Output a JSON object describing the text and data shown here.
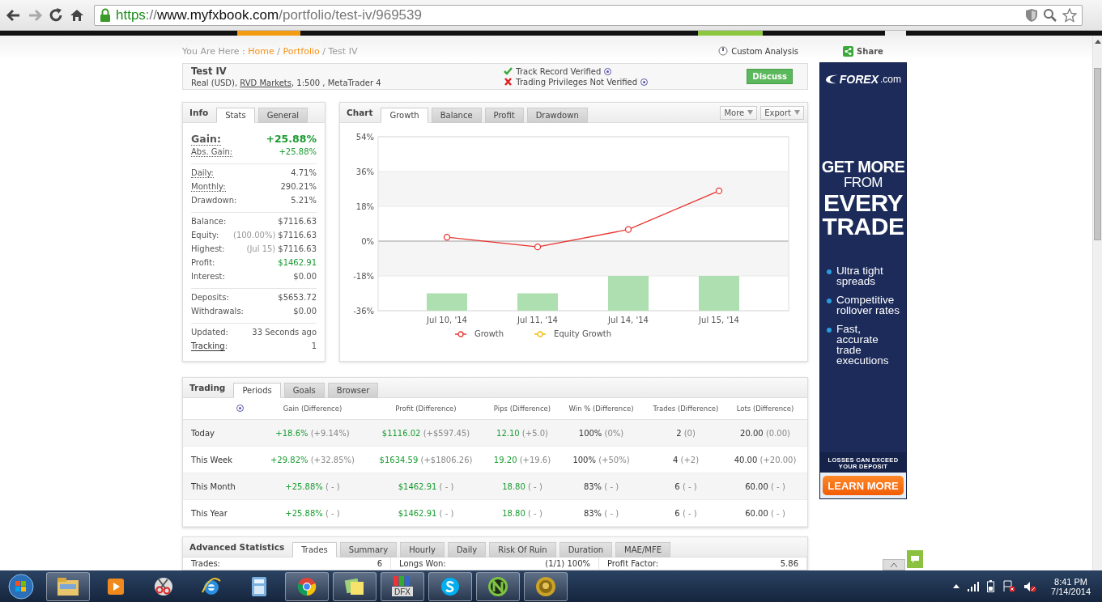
{
  "browser": {
    "url_parts": [
      {
        "kind": "scheme",
        "text": "https"
      },
      {
        "kind": "sep",
        "text": "://"
      },
      {
        "kind": "host",
        "text": "www.myfxbook.com"
      },
      {
        "kind": "path",
        "text": "/portfolio/test-iv/969539"
      }
    ]
  },
  "breadcrumb": {
    "prefix": "You Are Here :",
    "links": [
      "Home",
      "Portfolio"
    ],
    "separator": "/",
    "current": "Test IV"
  },
  "custom_analysis": "Custom Analysis",
  "share": "Share",
  "account": {
    "name": "Test IV",
    "type": "Real (USD),",
    "broker": "RVD Markets",
    "details": ", 1:500 , MetaTrader 4",
    "verifications": [
      {
        "text": "Track Record Verified",
        "verified": true
      },
      {
        "text": "Trading Privileges Not Verified",
        "verified": false
      }
    ],
    "discuss": "Discuss"
  },
  "info": {
    "title": "Info",
    "tabs": [
      {
        "label": "Stats",
        "selected": true
      },
      {
        "label": "General",
        "selected": false
      }
    ],
    "groups": [
      [
        {
          "label": "Gain:",
          "value": "+25.88%",
          "kind": "headline",
          "positive": true,
          "dotted": true
        },
        {
          "label": "Abs. Gain:",
          "value": "+25.88%",
          "positive": true,
          "dotted": true
        }
      ],
      [
        {
          "label": "Daily:",
          "value": "4.71%",
          "dotted": true
        },
        {
          "label": "Monthly:",
          "value": "290.21%",
          "dotted": true
        },
        {
          "label": "Drawdown:",
          "value": "5.21%"
        }
      ],
      [
        {
          "label": "Balance:",
          "value": "$7116.63"
        },
        {
          "label": "Equity:",
          "note": "(100.00%)",
          "value": "$7116.63"
        },
        {
          "label": "Highest:",
          "note": "(Jul 15)",
          "value": "$7116.63"
        },
        {
          "label": "Profit:",
          "value": "$1462.91",
          "positive": true
        },
        {
          "label": "Interest:",
          "value": "$0.00"
        }
      ],
      [
        {
          "label": "Deposits:",
          "value": "$5653.72"
        },
        {
          "label": "Withdrawals:",
          "value": "$0.00"
        }
      ],
      [
        {
          "label": "Updated:",
          "value": "33 Seconds ago"
        },
        {
          "label": "Tracking",
          "suffix": ":",
          "value": "1",
          "link": true
        }
      ]
    ]
  },
  "chart": {
    "title": "Chart",
    "tabs": [
      {
        "label": "Growth",
        "selected": true
      },
      {
        "label": "Balance",
        "selected": false
      },
      {
        "label": "Profit",
        "selected": false
      },
      {
        "label": "Drawdown",
        "selected": false
      }
    ],
    "menus": [
      "More",
      "Export"
    ],
    "chart_data": {
      "type": "line",
      "grid": true,
      "categories": [
        "Jul 10, '14",
        "Jul 11, '14",
        "Jul 14, '14",
        "Jul 15, '14"
      ],
      "ylim": [
        -36,
        54
      ],
      "yticks": [
        {
          "value": 54,
          "label": "54%"
        },
        {
          "value": 36,
          "label": "36%"
        },
        {
          "value": 18,
          "label": "18%"
        },
        {
          "value": 0,
          "label": "0%"
        },
        {
          "value": -18,
          "label": "-18%"
        },
        {
          "value": -36,
          "label": "-36%"
        }
      ],
      "series": [
        {
          "name": "Growth",
          "color": "#e8332f",
          "marker": "circle",
          "values": [
            2,
            -3,
            6,
            26
          ]
        },
        {
          "name": "Equity Growth",
          "color": "#f5b800",
          "marker": "circle",
          "values": [
            null,
            null,
            null,
            null
          ]
        },
        {
          "type": "bar",
          "base": [
            -36,
            -36,
            -36,
            -36
          ],
          "color": "#addfb1",
          "values": [
            9,
            9,
            18,
            18
          ]
        }
      ]
    }
  },
  "trading": {
    "title": "Trading",
    "tabs": [
      {
        "label": "Periods",
        "selected": true
      },
      {
        "label": "Goals",
        "selected": false
      },
      {
        "label": "Browser",
        "selected": false
      }
    ],
    "columns": [
      "Gain (Difference)",
      "Profit (Difference)",
      "Pips (Difference)",
      "Win % (Difference)",
      "Trades (Difference)",
      "Lots (Difference)"
    ],
    "rows": [
      {
        "label": "Today",
        "cells": [
          {
            "value": "+18.6%",
            "diff": "(+9.14%)",
            "positive": true
          },
          {
            "value": "$1116.02",
            "diff": "(+$597.45)",
            "positive": true
          },
          {
            "value": "12.10",
            "diff": "(+5.0)",
            "positive": true
          },
          {
            "value": "100%",
            "diff": "(0%)"
          },
          {
            "value": "2",
            "diff": "(0)"
          },
          {
            "value": "20.00",
            "diff": "(0.00)"
          }
        ]
      },
      {
        "label": "This Week",
        "cells": [
          {
            "value": "+29.82%",
            "diff": "(+32.85%)",
            "positive": true
          },
          {
            "value": "$1634.59",
            "diff": "(+$1806.26)",
            "positive": true
          },
          {
            "value": "19.20",
            "diff": "(+19.6)",
            "positive": true
          },
          {
            "value": "100%",
            "diff": "(+50%)"
          },
          {
            "value": "4",
            "diff": "(+2)"
          },
          {
            "value": "40.00",
            "diff": "(+20.00)"
          }
        ]
      },
      {
        "label": "This Month",
        "cells": [
          {
            "value": "+25.88%",
            "diff": "( - )",
            "positive": true
          },
          {
            "value": "$1462.91",
            "diff": "( - )",
            "positive": true
          },
          {
            "value": "18.80",
            "diff": "( - )",
            "positive": true
          },
          {
            "value": "83%",
            "diff": "( - )"
          },
          {
            "value": "6",
            "diff": "( - )"
          },
          {
            "value": "60.00",
            "diff": "( - )"
          }
        ]
      },
      {
        "label": "This Year",
        "cells": [
          {
            "value": "+25.88%",
            "diff": "( - )",
            "positive": true
          },
          {
            "value": "$1462.91",
            "diff": "( - )",
            "positive": true
          },
          {
            "value": "18.80",
            "diff": "( - )",
            "positive": true
          },
          {
            "value": "83%",
            "diff": "( - )"
          },
          {
            "value": "6",
            "diff": "( - )"
          },
          {
            "value": "60.00",
            "diff": "( - )"
          }
        ]
      }
    ]
  },
  "advanced": {
    "title": "Advanced Statistics",
    "tabs": [
      {
        "label": "Trades",
        "selected": true
      },
      {
        "label": "Summary",
        "selected": false
      },
      {
        "label": "Hourly",
        "selected": false
      },
      {
        "label": "Daily",
        "selected": false
      },
      {
        "label": "Risk Of Ruin",
        "selected": false
      },
      {
        "label": "Duration",
        "selected": false
      },
      {
        "label": "MAE/MFE",
        "selected": false
      }
    ],
    "stats": [
      {
        "label": "Trades:",
        "value": "6"
      },
      {
        "label": "Longs Won:",
        "value": "(1/1) 100%"
      },
      {
        "label": "Profit Factor:",
        "value": "5.86"
      }
    ]
  },
  "ad": {
    "logo_bold": "FOREX",
    "logo_rest": ".com",
    "headline": [
      {
        "text": "GET MORE",
        "kind": "bold"
      },
      {
        "text": "FROM",
        "kind": "light"
      },
      {
        "text": "EVERY",
        "kind": "big"
      },
      {
        "text": "TRADE",
        "kind": "big"
      }
    ],
    "bullets": [
      "Ultra tight spreads",
      "Competitive rollover rates",
      "Fast, accurate trade executions"
    ],
    "disclaimer": [
      "LOSSES CAN EXCEED",
      "YOUR DEPOSIT"
    ],
    "button": "LEARN MORE"
  },
  "taskbar": {
    "apps": [
      {
        "kind": "folder",
        "running": true
      },
      {
        "kind": "media",
        "running": false
      },
      {
        "kind": "scissors",
        "running": false
      },
      {
        "kind": "ie",
        "running": false
      },
      {
        "kind": "calculator",
        "running": false
      },
      {
        "kind": "chrome",
        "running": true
      },
      {
        "kind": "notes",
        "running": true
      },
      {
        "kind": "dfx",
        "running": true,
        "label": "DFX"
      },
      {
        "kind": "skype",
        "running": true
      },
      {
        "kind": "n",
        "running": true
      },
      {
        "kind": "coin",
        "running": true
      }
    ],
    "time": "8:41 PM",
    "date": "7/14/2014"
  }
}
